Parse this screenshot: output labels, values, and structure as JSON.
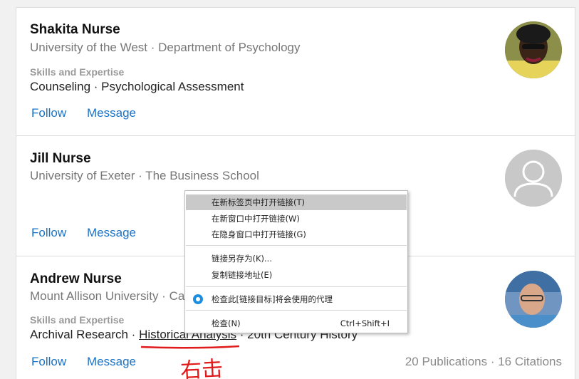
{
  "cards": [
    {
      "name": "Shakita Nurse",
      "affiliation": "University of the West · Department of Psychology",
      "skills_title": "Skills and Expertise",
      "skills": "Counseling · Psychological Assessment",
      "follow": "Follow",
      "message": "Message"
    },
    {
      "name": "Jill Nurse",
      "affiliation": "University of Exeter · The Business School",
      "follow": "Follow",
      "message": "Message"
    },
    {
      "name": "Andrew Nurse",
      "affiliation": "Mount Allison University · Ca",
      "skills_title": "Skills and Expertise",
      "skills_pre": "Archival Research · ",
      "skills_link": "Historical Analysis",
      "skills_post": " · 20th Century History",
      "follow": "Follow",
      "message": "Message",
      "stats": "20 Publications · 16 Citations"
    }
  ],
  "context_menu": {
    "items": [
      "在新标签页中打开链接(T)",
      "在新窗口中打开链接(W)",
      "在隐身窗口中打开链接(G)",
      "链接另存为(K)...",
      "复制链接地址(E)",
      "检查此[链接目标]将会使用的代理",
      "检查(N)"
    ],
    "inspect_shortcut": "Ctrl+Shift+I",
    "highlighted_index": 0
  },
  "annotation": {
    "text": "右击",
    "color": "#e11b1b"
  },
  "colors": {
    "link": "#1a73c8",
    "muted": "#777777",
    "menu_highlight": "#c9c9c9"
  }
}
